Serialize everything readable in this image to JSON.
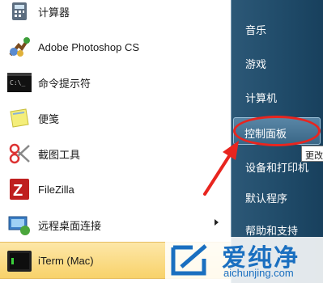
{
  "programs": [
    {
      "label": "计算器",
      "icon": "calculator-icon"
    },
    {
      "label": "Adobe Photoshop CS",
      "icon": "photoshop-icon"
    },
    {
      "label": "命令提示符",
      "icon": "command-prompt-icon"
    },
    {
      "label": "便笺",
      "icon": "sticky-notes-icon"
    },
    {
      "label": "截图工具",
      "icon": "snipping-tool-icon"
    },
    {
      "label": "FileZilla",
      "icon": "filezilla-icon"
    },
    {
      "label": "远程桌面连接",
      "icon": "remote-desktop-icon"
    },
    {
      "label": "iTerm (Mac)",
      "icon": "iterm-icon"
    }
  ],
  "right_menu": [
    {
      "label": "音乐"
    },
    {
      "label": "游戏"
    },
    {
      "label": "计算机"
    },
    {
      "label": "控制面板"
    },
    {
      "label": "设备和打印机"
    },
    {
      "label": "默认程序"
    },
    {
      "label": "帮助和支持"
    }
  ],
  "tooltip": "更改",
  "watermark": {
    "title": "爱纯净",
    "domain": "aichunjing.com"
  },
  "colors": {
    "highlight": "#f8d26a",
    "ring": "#e8251f",
    "right_pane": "#1f4a68",
    "brand": "#1a6fc0"
  }
}
